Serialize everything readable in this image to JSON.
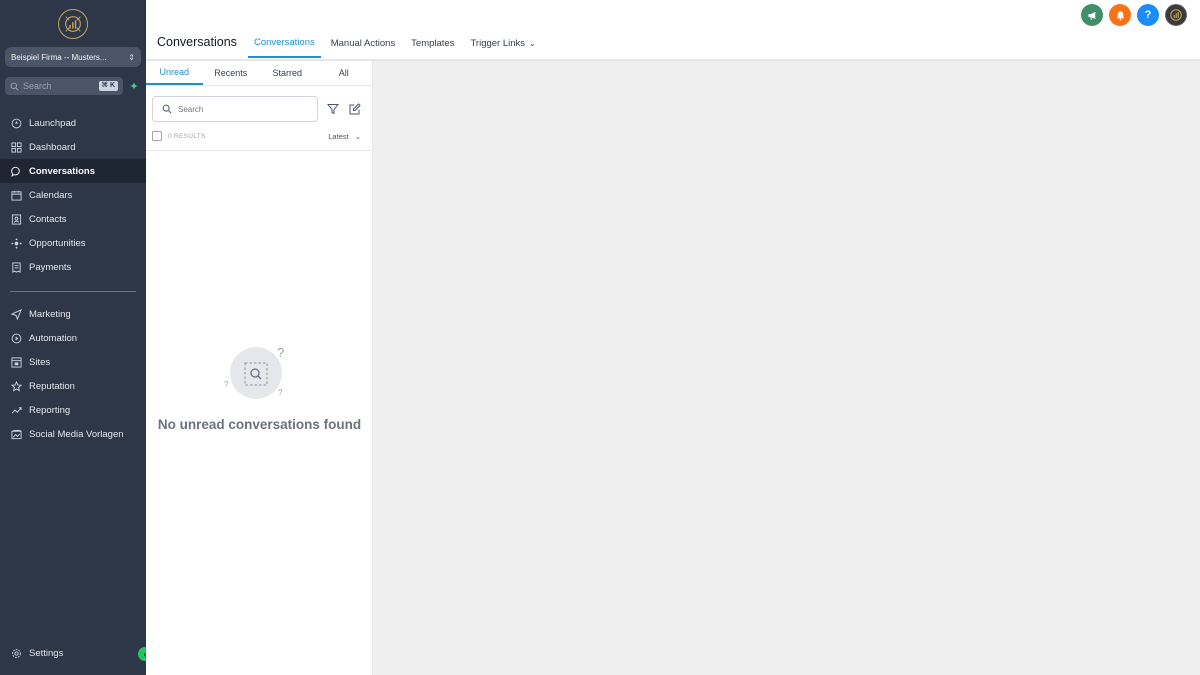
{
  "sidebar": {
    "account_name": "Beispiel Firma -- Musters...",
    "search_placeholder": "Search",
    "search_shortcut": "⌘ K",
    "items_primary": [
      {
        "label": "Launchpad",
        "icon": "rocket-icon"
      },
      {
        "label": "Dashboard",
        "icon": "grid-icon"
      },
      {
        "label": "Conversations",
        "icon": "chat-bubble-icon",
        "active": true
      },
      {
        "label": "Calendars",
        "icon": "calendar-icon"
      },
      {
        "label": "Contacts",
        "icon": "contacts-icon"
      },
      {
        "label": "Opportunities",
        "icon": "opportunities-icon"
      },
      {
        "label": "Payments",
        "icon": "receipt-icon"
      }
    ],
    "items_secondary": [
      {
        "label": "Marketing",
        "icon": "paper-plane-icon"
      },
      {
        "label": "Automation",
        "icon": "automation-icon"
      },
      {
        "label": "Sites",
        "icon": "sites-icon"
      },
      {
        "label": "Reputation",
        "icon": "star-icon"
      },
      {
        "label": "Reporting",
        "icon": "trend-icon"
      },
      {
        "label": "Social Media Vorlagen",
        "icon": "social-media-icon"
      }
    ],
    "settings_label": "Settings"
  },
  "header": {
    "title": "Conversations",
    "tabs": [
      {
        "label": "Conversations",
        "active": true
      },
      {
        "label": "Manual Actions"
      },
      {
        "label": "Templates"
      },
      {
        "label": "Trigger Links",
        "dropdown": true
      }
    ],
    "icons": [
      "announcement-icon",
      "notification-bell-icon",
      "help-icon",
      "user-avatar"
    ]
  },
  "list": {
    "subtabs": [
      {
        "label": "Unread",
        "active": true
      },
      {
        "label": "Recents"
      },
      {
        "label": "Starred"
      },
      {
        "label": "All"
      }
    ],
    "search_placeholder": "Search",
    "results_label": "0 RESULTS",
    "sort_label": "Latest",
    "empty_message": "No unread conversations found"
  },
  "colors": {
    "sidebar_bg": "#2d3748",
    "accent": "#1f8fcf",
    "announce": "#3f8f6b",
    "bell": "#f97316",
    "help": "#1d8cf8"
  }
}
